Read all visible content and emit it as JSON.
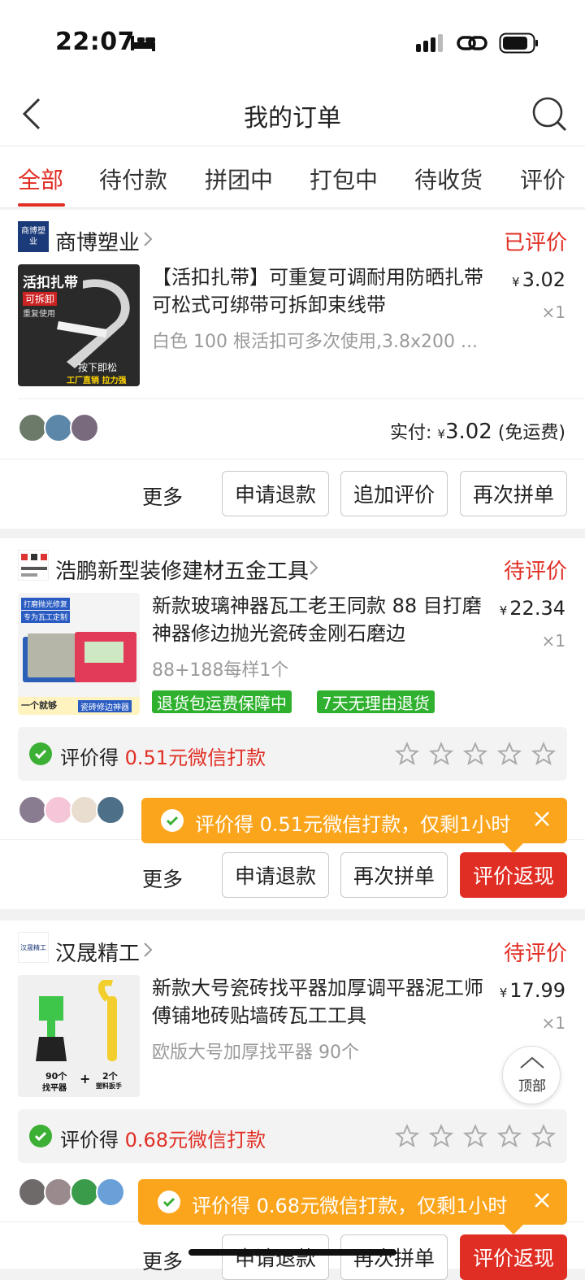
{
  "status_bar": {
    "time": "22:07"
  },
  "nav": {
    "title": "我的订单"
  },
  "tabs": [
    {
      "label": "全部",
      "active": true
    },
    {
      "label": "待付款"
    },
    {
      "label": "拼团中"
    },
    {
      "label": "打包中"
    },
    {
      "label": "待收货"
    },
    {
      "label": "评价"
    }
  ],
  "orders": [
    {
      "store_name": "商博塑业",
      "store_logo_text": "商博塑业",
      "status": "已评价",
      "title": "【活扣扎带】可重复可调耐用防晒扎带可松式可绑带可拆卸束线带",
      "spec": "白色 100 根活扣可多次使用,3.8x200 ...",
      "currency": "¥",
      "price": "3.02",
      "qty": "×1",
      "thumb_text": [
        "活扣扎带",
        "可拆卸",
        "重复使用",
        "按下即松",
        "工厂直销 拉力强"
      ],
      "paid_label": "实付:",
      "paid_amount": "3.02",
      "shipping": "(免运费)",
      "more": "更多",
      "buttons": [
        "申请退款",
        "追加评价",
        "再次拼单"
      ]
    },
    {
      "store_name": "浩鹏新型装修建材五金工具",
      "status": "待评价",
      "title": "新款玻璃神器瓦工老王同款 88 目打磨神器修边抛光瓷砖金刚石磨边",
      "spec": "88+188每样1个",
      "currency": "¥",
      "price": "22.34",
      "qty": "×1",
      "thumb_text": [
        "打磨抛光修复",
        "专为瓦工定制",
        "一个就够",
        "瓷砖修边神器"
      ],
      "badges": [
        "退货包运费保障中",
        "7天无理由退货"
      ],
      "review_prefix": "评价得 ",
      "review_amount": "0.51元微信打款",
      "tooltip": "评价得 0.51元微信打款，仅剩1小时",
      "more": "更多",
      "buttons": [
        "申请退款",
        "再次拼单",
        "评价返现"
      ]
    },
    {
      "store_name": "汉晟精工",
      "store_logo_text": "汉晟精工",
      "status": "待评价",
      "title": "新款大号瓷砖找平器加厚调平器泥工师傅铺地砖贴墙砖瓦工工具",
      "spec": "欧版大号加厚找平器 90个",
      "currency": "¥",
      "price": "17.99",
      "qty": "×1",
      "thumb_text": [
        "90个",
        "找平器",
        "+",
        "2个",
        "塑料扳手"
      ],
      "review_prefix": "评价得 ",
      "review_amount": "0.68元微信打款",
      "tooltip": "评价得 0.68元微信打款，仅剩1小时",
      "more": "更多",
      "buttons": [
        "申请退款",
        "再次拼单",
        "评价返现"
      ]
    }
  ],
  "back_to_top": "顶部",
  "colors": {
    "accent": "#e02e24",
    "green": "#2fb12f",
    "orange": "#fba51c",
    "wechat": "#3cb034"
  }
}
